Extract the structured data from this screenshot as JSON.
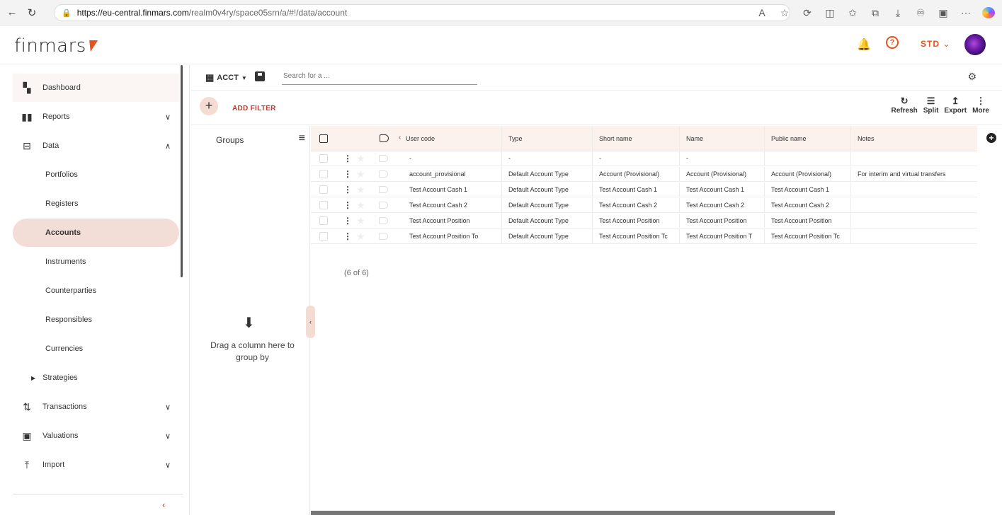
{
  "browser": {
    "url_host": "https://eu-central.finmars.com",
    "url_path": "/realm0v4ry/space05srn/a/#!/data/account"
  },
  "header": {
    "logo": "finmars",
    "user_label": "STD"
  },
  "sidebar": {
    "items": [
      {
        "label": "Dashboard",
        "icon": "dashboard-icon"
      },
      {
        "label": "Reports",
        "icon": "bar-chart-icon"
      },
      {
        "label": "Data",
        "icon": "data-tree-icon"
      },
      {
        "label": "Portfolios"
      },
      {
        "label": "Registers"
      },
      {
        "label": "Accounts"
      },
      {
        "label": "Instruments"
      },
      {
        "label": "Counterparties"
      },
      {
        "label": "Responsibles"
      },
      {
        "label": "Currencies"
      },
      {
        "label": "Strategies"
      },
      {
        "label": "Transactions",
        "icon": "transactions-icon"
      },
      {
        "label": "Valuations",
        "icon": "valuations-icon"
      },
      {
        "label": "Import",
        "icon": "import-icon"
      }
    ]
  },
  "toolbar": {
    "layout_label": "ACCT",
    "search_placeholder": "Search for a ...",
    "add_filter_label": "ADD FILTER",
    "actions": [
      {
        "label": "Refresh",
        "icon": "refresh-icon"
      },
      {
        "label": "Split",
        "icon": "split-icon"
      },
      {
        "label": "Export",
        "icon": "export-icon"
      },
      {
        "label": "More",
        "icon": "more-vertical-icon"
      }
    ]
  },
  "groups": {
    "title": "Groups",
    "drop_text": "Drag a column here to group by"
  },
  "table": {
    "columns": [
      "User code",
      "Type",
      "Short name",
      "Name",
      "Public name",
      "Notes"
    ],
    "rows": [
      [
        "-",
        "-",
        "-",
        "-",
        "",
        ""
      ],
      [
        "account_provisional",
        "Default Account Type",
        "Account (Provisional)",
        "Account (Provisional)",
        "Account (Provisional)",
        "For interim and virtual transfers"
      ],
      [
        "Test Account Cash 1",
        "Default Account Type",
        "Test Account Cash 1",
        "Test Account Cash 1",
        "Test Account Cash 1",
        ""
      ],
      [
        "Test Account Cash 2",
        "Default Account Type",
        "Test Account Cash 2",
        "Test Account Cash 2",
        "Test Account Cash 2",
        ""
      ],
      [
        "Test Account Position",
        "Default Account Type",
        "Test Account Position",
        "Test Account Position",
        "Test Account Position",
        ""
      ],
      [
        "Test Account Position To",
        "Default Account Type",
        "Test Account Position Tc",
        "Test Account Position T",
        "Test Account Position Tc",
        ""
      ]
    ],
    "count_label": "(6 of 6)"
  }
}
